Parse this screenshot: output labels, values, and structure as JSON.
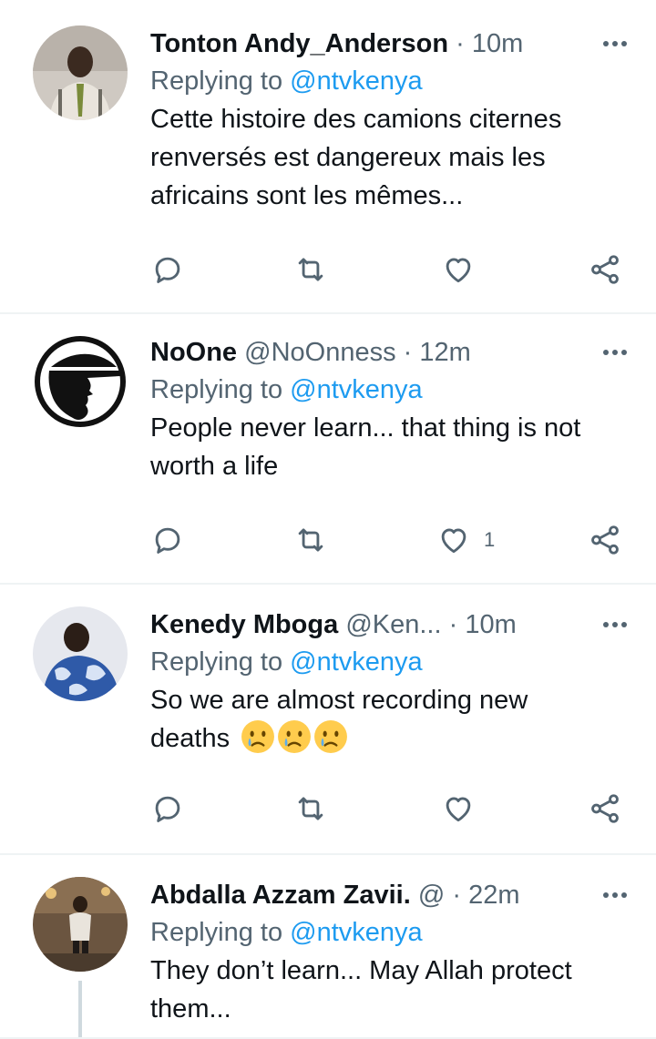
{
  "tweets": [
    {
      "name": "Tonton Andy_Anderson",
      "handle": "",
      "separator": "·",
      "time": "10m",
      "reply_prefix": "Replying to ",
      "reply_to": "@ntvkenya",
      "text_lines": [
        "Cette histoire des camions citernes",
        "renversés est dangereux mais les",
        "africains sont les mêmes..."
      ],
      "like_count": ""
    },
    {
      "name": "NoOne",
      "handle": "@NoOnness",
      "separator": "·",
      "time": "12m",
      "reply_prefix": "Replying to ",
      "reply_to": "@ntvkenya",
      "text_lines": [
        "People never learn... that thing is not",
        "worth a life"
      ],
      "like_count": "1"
    },
    {
      "name": "Kenedy Mboga",
      "handle": "@Ken...",
      "separator": "·",
      "time": "10m",
      "reply_prefix": "Replying to ",
      "reply_to": "@ntvkenya",
      "text_lines": [
        "So we are almost recording new",
        "deaths"
      ],
      "emoji": "😢😢😢",
      "like_count": ""
    },
    {
      "name": "Abdalla Azzam Zavii.",
      "handle": "@",
      "separator": "·",
      "time": "22m",
      "reply_prefix": "Replying to ",
      "reply_to": "@ntvkenya",
      "text_lines": [
        "They don’t learn... May Allah protect",
        "them..."
      ],
      "like_count": ""
    }
  ],
  "icons": {
    "reply": "reply-icon",
    "retweet": "retweet-icon",
    "like": "heart-icon",
    "share": "share-icon",
    "more": "more-icon"
  },
  "colors": {
    "text": "#0f1419",
    "secondary": "#536471",
    "link": "#1d9bf0",
    "divider": "#eff3f4"
  }
}
